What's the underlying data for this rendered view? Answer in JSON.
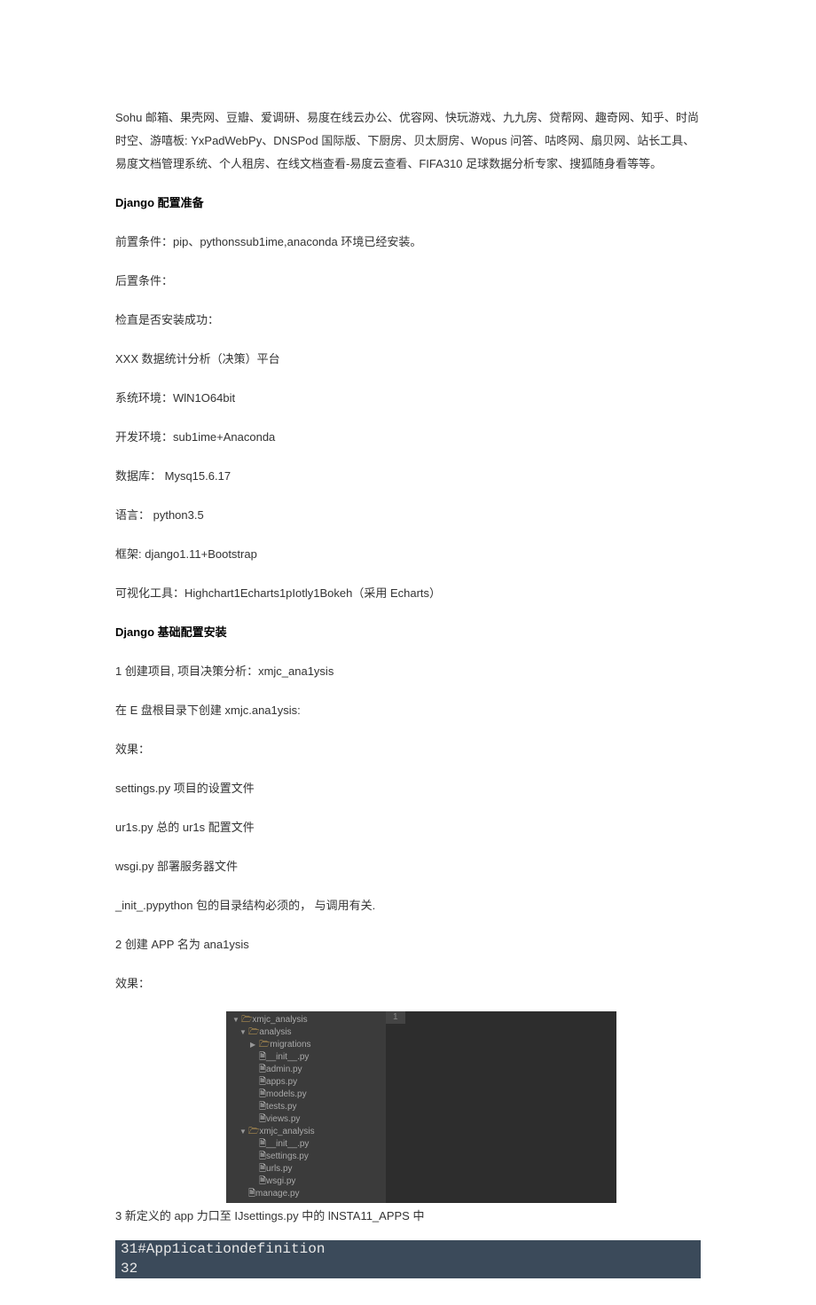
{
  "paragraphs": {
    "p0": "Sohu 邮箱、果壳网、豆瓣、爱调研、易度在线云办公、优容网、快玩游戏、九九房、贷帮网、趣奇网、知乎、时尚时空、游嘻板: YxPadWebPy、DNSPod 国际版、下厨房、贝太厨房、Wopus 问答、咕咚网、扇贝网、站长工具、易度文档管理系统、个人租房、在线文档查看-易度云查看、FIFA310 足球数据分析专家、搜狐随身看等等。",
    "h1": "Django 配置准备",
    "p1": "前置条件：pip、pythonssub1ime,anaconda 环境已经安装。",
    "p2": "后置条件：",
    "p3": "检直是否安装成功：",
    "p4": "XXX 数据统计分析（决策）平台",
    "p5": "系统环境：WlN1O64bit",
    "p6": "开发环境：sub1ime+Anaconda",
    "p7": "数据库： Mysq15.6.17",
    "p8": "语言： python3.5",
    "p9": "框架: django1.11+Bootstrap",
    "p10": "可视化工具：Highchart1Echarts1pIotly1Bokeh（采用 Echarts）",
    "h2": "Django 基础配置安装",
    "p11": "1 创建项目, 项目决策分析：xmjc_ana1ysis",
    "p12": "在 E 盘根目录下创建 xmjc.ana1ysis:",
    "p13": "效果：",
    "p14": "settings.py 项目的设置文件",
    "p15": "ur1s.py 总的 ur1s 配置文件",
    "p16": "wsgi.py 部署服务器文件",
    "p17": "_init_.pypython 包的目录结构必须的， 与调用有关.",
    "p18": "2 创建 APP 名为 ana1ysis",
    "p19": "效果：",
    "p20": "3 新定义的 app 力口至 IJsettings.py 中的 lNSTA11_APPS 中"
  },
  "tree": [
    {
      "indent": "",
      "type": "folder-open",
      "name": "xmjc_analysis"
    },
    {
      "indent": "ind1",
      "type": "folder-open",
      "name": "analysis"
    },
    {
      "indent": "ind2",
      "type": "folder-closed",
      "name": "migrations"
    },
    {
      "indent": "ind2",
      "type": "file",
      "name": "__init__.py"
    },
    {
      "indent": "ind2",
      "type": "file",
      "name": "admin.py"
    },
    {
      "indent": "ind2",
      "type": "file",
      "name": "apps.py"
    },
    {
      "indent": "ind2",
      "type": "file",
      "name": "models.py"
    },
    {
      "indent": "ind2",
      "type": "file",
      "name": "tests.py"
    },
    {
      "indent": "ind2",
      "type": "file",
      "name": "views.py"
    },
    {
      "indent": "ind1",
      "type": "folder-open",
      "name": "xmjc_analysis"
    },
    {
      "indent": "ind2",
      "type": "file",
      "name": "__init__.py"
    },
    {
      "indent": "ind2",
      "type": "file",
      "name": "settings.py"
    },
    {
      "indent": "ind2",
      "type": "file",
      "name": "urls.py"
    },
    {
      "indent": "ind2",
      "type": "file",
      "name": "wsgi.py"
    },
    {
      "indent": "ind1",
      "type": "file",
      "name": "manage.py"
    }
  ],
  "editor": {
    "gutter_line": "1"
  },
  "code": {
    "l1": "31#App1icationdefinition",
    "l2": "32"
  }
}
